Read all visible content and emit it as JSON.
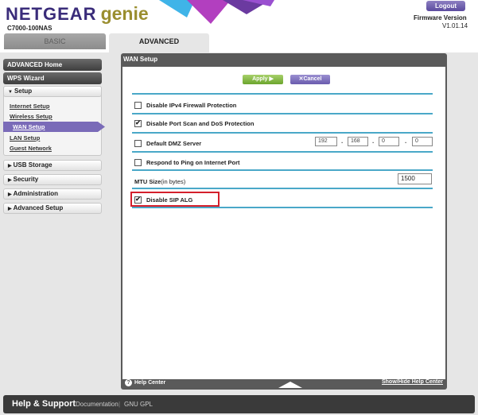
{
  "header": {
    "brand": "NETGEAR",
    "product": "genie",
    "model": "C7000-100NAS",
    "logout_label": "Logout",
    "firmware_label": "Firmware Version",
    "firmware_version": "V1.01.14"
  },
  "tabs": {
    "basic": "BASIC",
    "advanced": "ADVANCED",
    "active": "ADVANCED"
  },
  "sidebar": {
    "advanced_home": "ADVANCED Home",
    "wps_wizard": "WPS Wizard",
    "setup": "Setup",
    "setup_items": [
      "Internet Setup",
      "Wireless Setup",
      "WAN Setup",
      "LAN Setup",
      "Guest Network"
    ],
    "active_item": "WAN Setup",
    "usb_storage": "USB Storage",
    "security": "Security",
    "administration": "Administration",
    "advanced_setup": "Advanced Setup"
  },
  "panel": {
    "title": "WAN Setup",
    "apply_label": "Apply",
    "cancel_label": "Cancel",
    "options": {
      "ipv4_firewall": {
        "label": "Disable IPv4 Firewall Protection",
        "checked": false
      },
      "port_scan": {
        "label": "Disable Port Scan and DoS Protection",
        "checked": true
      },
      "dmz": {
        "label": "Default DMZ Server",
        "checked": false
      },
      "ping": {
        "label": "Respond to Ping on Internet Port",
        "checked": false
      },
      "sip_alg": {
        "label": "Disable SIP ALG",
        "checked": true
      }
    },
    "dmz_ip": [
      "192",
      "168",
      "0",
      "0"
    ],
    "mtu": {
      "label": "MTU Size",
      "note": "(in bytes)",
      "value": "1500"
    },
    "footer": {
      "help_center": "Help Center",
      "show_hide": "Show/Hide Help Center"
    }
  },
  "bottom_bar": {
    "title": "Help & Support",
    "documentation": "Documentation",
    "separator": "|",
    "gnu_gpl": "GNU GPL"
  },
  "colors": {
    "brand_purple": "#3a2c7a",
    "genie_gold": "#9a8e2f",
    "apply_green": "#6ba52d",
    "cancel_purple": "#6a5cae",
    "divider_blue": "#4aa8c8",
    "highlight_red": "#d41f2b"
  }
}
